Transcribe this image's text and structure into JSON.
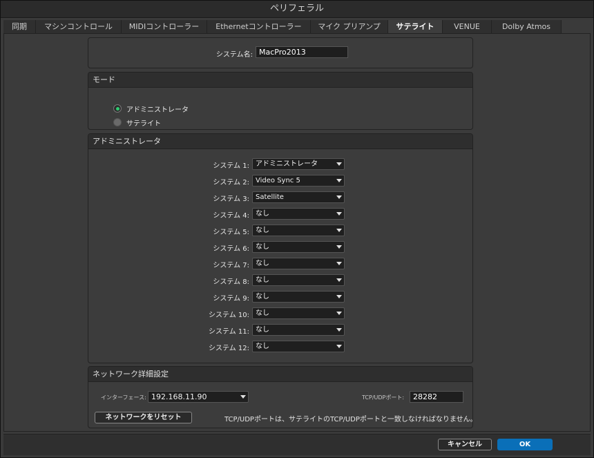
{
  "window": {
    "title": "ペリフェラル"
  },
  "tabs": [
    {
      "label": "同期",
      "active": false
    },
    {
      "label": "マシンコントロール",
      "active": false
    },
    {
      "label": "MIDIコントローラー",
      "active": false
    },
    {
      "label": "Ethernetコントローラー",
      "active": false
    },
    {
      "label": "マイク プリアンプ",
      "active": false
    },
    {
      "label": "サテライト",
      "active": true
    },
    {
      "label": "VENUE",
      "active": false
    },
    {
      "label": "Dolby Atmos",
      "active": false
    }
  ],
  "system_name": {
    "label": "システム名:",
    "value": "MacPro2013"
  },
  "mode": {
    "header": "モード",
    "options": [
      {
        "label": "アドミニストレータ",
        "selected": true
      },
      {
        "label": "サテライト",
        "selected": false
      }
    ]
  },
  "admin": {
    "header": "アドミニストレータ",
    "systems": [
      {
        "label": "システム 1:",
        "value": "アドミニストレータ"
      },
      {
        "label": "システム 2:",
        "value": "Video Sync 5"
      },
      {
        "label": "システム 3:",
        "value": "Satellite"
      },
      {
        "label": "システム 4:",
        "value": "なし"
      },
      {
        "label": "システム 5:",
        "value": "なし"
      },
      {
        "label": "システム 6:",
        "value": "なし"
      },
      {
        "label": "システム 7:",
        "value": "なし"
      },
      {
        "label": "システム 8:",
        "value": "なし"
      },
      {
        "label": "システム 9:",
        "value": "なし"
      },
      {
        "label": "システム 10:",
        "value": "なし"
      },
      {
        "label": "システム 11:",
        "value": "なし"
      },
      {
        "label": "システム 12:",
        "value": "なし"
      }
    ]
  },
  "network": {
    "header": "ネットワーク詳細設定",
    "interface_label": "インターフェース:",
    "interface_value": "192.168.11.90",
    "port_label": "TCP/UDPポート:",
    "port_value": "28282",
    "reset_button": "ネットワークをリセット",
    "note": "TCP/UDPポートは、サテライトのTCP/UDPポートと一致しなければなりません。"
  },
  "footer": {
    "cancel": "キャンセル",
    "ok": "OK"
  }
}
